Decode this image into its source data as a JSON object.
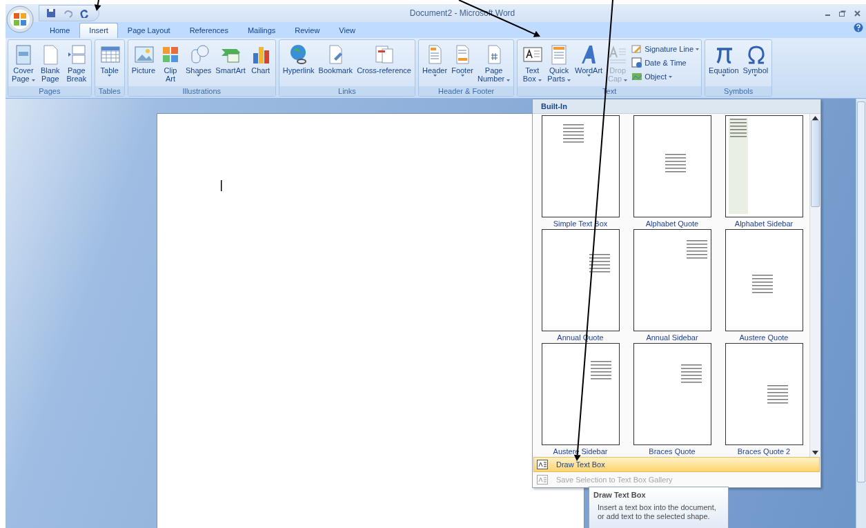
{
  "title_bar": {
    "title": "Document2 - Microsoft Word"
  },
  "tabs": [
    {
      "label": "Home",
      "selected": false
    },
    {
      "label": "Insert",
      "selected": true
    },
    {
      "label": "Page Layout",
      "selected": false
    },
    {
      "label": "References",
      "selected": false
    },
    {
      "label": "Mailings",
      "selected": false
    },
    {
      "label": "Review",
      "selected": false
    },
    {
      "label": "View",
      "selected": false
    }
  ],
  "ribbon_groups": [
    {
      "label": "Pages",
      "buttons": [
        {
          "lines": [
            "Cover",
            "Page"
          ],
          "caret": true
        },
        {
          "lines": [
            "Blank",
            "Page"
          ],
          "caret": false
        },
        {
          "lines": [
            "Page",
            "Break"
          ],
          "caret": false
        }
      ]
    },
    {
      "label": "Tables",
      "buttons": [
        {
          "lines": [
            "Table"
          ],
          "caret": true
        }
      ]
    },
    {
      "label": "Illustrations",
      "buttons": [
        {
          "lines": [
            "Picture"
          ],
          "caret": false
        },
        {
          "lines": [
            "Clip",
            "Art"
          ],
          "caret": false
        },
        {
          "lines": [
            "Shapes"
          ],
          "caret": true
        },
        {
          "lines": [
            "SmartArt"
          ],
          "caret": false
        },
        {
          "lines": [
            "Chart"
          ],
          "caret": false
        }
      ]
    },
    {
      "label": "Links",
      "buttons": [
        {
          "lines": [
            "Hyperlink"
          ],
          "caret": false
        },
        {
          "lines": [
            "Bookmark"
          ],
          "caret": false
        },
        {
          "lines": [
            "Cross-reference"
          ],
          "caret": false
        }
      ]
    },
    {
      "label": "Header & Footer",
      "buttons": [
        {
          "lines": [
            "Header"
          ],
          "caret": true
        },
        {
          "lines": [
            "Footer"
          ],
          "caret": true
        },
        {
          "lines": [
            "Page",
            "Number"
          ],
          "caret": true
        }
      ]
    },
    {
      "label": "Text",
      "buttons": [
        {
          "lines": [
            "Text",
            "Box"
          ],
          "caret": true
        },
        {
          "lines": [
            "Quick",
            "Parts"
          ],
          "caret": true
        },
        {
          "lines": [
            "WordArt"
          ],
          "caret": true
        },
        {
          "lines": [
            "Drop",
            "Cap"
          ],
          "caret": true,
          "disabled": true
        }
      ],
      "small_buttons": [
        {
          "label": "Signature Line",
          "caret": true
        },
        {
          "label": "Date & Time",
          "caret": false
        },
        {
          "label": "Object",
          "caret": true
        }
      ]
    },
    {
      "label": "Symbols",
      "buttons": [
        {
          "lines": [
            "Equation"
          ],
          "caret": true
        },
        {
          "lines": [
            "Symbol"
          ],
          "caret": true
        }
      ]
    }
  ],
  "text_box_menu": {
    "heading": "Built-In",
    "gallery": [
      {
        "caption": "Simple Text Box"
      },
      {
        "caption": "Alphabet Quote"
      },
      {
        "caption": "Alphabet Sidebar"
      },
      {
        "caption": "Annual Quote"
      },
      {
        "caption": "Annual Sidebar"
      },
      {
        "caption": "Austere Quote"
      },
      {
        "caption": "Austere Sidebar"
      },
      {
        "caption": "Braces Quote"
      },
      {
        "caption": "Braces Quote 2"
      }
    ],
    "items": [
      {
        "label": "Draw Text Box",
        "selected": true,
        "disabled": false
      },
      {
        "label": "Save Selection to Text Box Gallery",
        "selected": false,
        "disabled": true
      }
    ]
  },
  "tooltip": {
    "title": "Draw Text Box",
    "text": "Insert a text box into the document, or add text to the selected shape."
  }
}
